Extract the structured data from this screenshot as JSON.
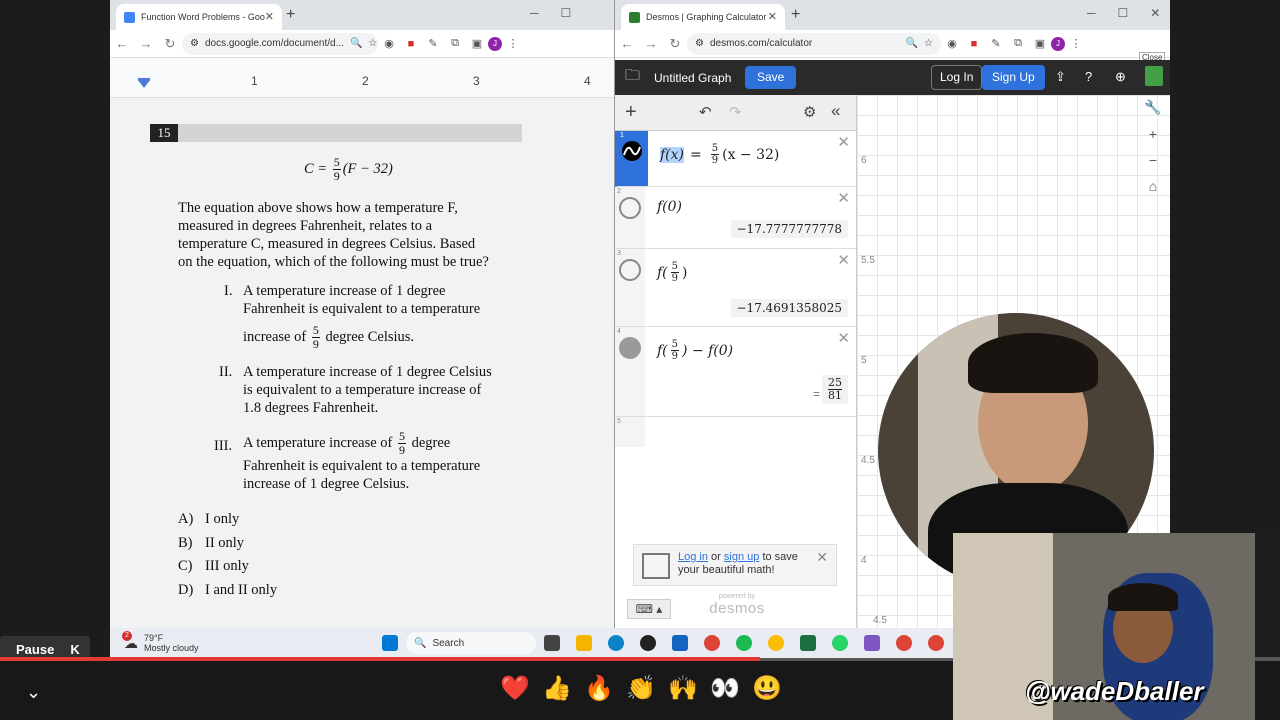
{
  "docs_window": {
    "tab_title": "Function Word Problems - Goo",
    "url": "docs.google.com/document/d...",
    "profile_initial": "J",
    "ruler_numbers": [
      "1",
      "2",
      "3",
      "4"
    ],
    "question_number": "15",
    "equation": {
      "lhs": "C =",
      "num": "5",
      "den": "9",
      "rhs": "(F − 32)"
    },
    "stem": [
      "The equation above shows how a temperature  F,",
      "measured in degrees Fahrenheit, relates to a",
      "temperature  C, measured in degrees Celsius.  Based",
      "on the equation, which of the following must be true?"
    ],
    "statements": [
      {
        "num": "I.",
        "line1": "A temperature increase of  1 degree",
        "line2": "Fahrenheit is equivalent to a temperature",
        "line3_pre": "increase of",
        "frac_num": "5",
        "frac_den": "9",
        "line3_post": "degree Celsius."
      },
      {
        "num": "II.",
        "line1": "A temperature increase of  1 degree Celsius",
        "line2": "is equivalent to a temperature increase of",
        "line3": "1.8 degrees Fahrenheit."
      },
      {
        "num": "III.",
        "line1_pre": "A temperature increase of",
        "frac_num": "5",
        "frac_den": "9",
        "line1_post": "degree",
        "line2": "Fahrenheit is equivalent to a temperature",
        "line3": "increase of 1 degree Celsius."
      }
    ],
    "choices": [
      {
        "letter": "A)",
        "text": "I only"
      },
      {
        "letter": "B)",
        "text": "II only"
      },
      {
        "letter": "C)",
        "text": "III only"
      },
      {
        "letter": "D)",
        "text": "I and II only"
      }
    ]
  },
  "desmos_window": {
    "tab_title": "Desmos | Graphing Calculator",
    "url": "desmos.com/calculator",
    "profile_initial": "J",
    "close_tooltip": "Close",
    "graph_title": "Untitled Graph",
    "save_label": "Save",
    "login_label": "Log In",
    "signup_label": "Sign Up",
    "expressions": [
      {
        "index": "1",
        "lhs": "f(x)",
        "eq": "=",
        "frac_num": "5",
        "frac_den": "9",
        "rhs": "(x − 32)"
      },
      {
        "index": "2",
        "expr": "f(0)",
        "result": "−17.7777777778"
      },
      {
        "index": "3",
        "expr_pre": "f(",
        "frac_num": "5",
        "frac_den": "9",
        "expr_post": ")",
        "result": "−17.4691358025"
      },
      {
        "index": "4",
        "expr_pre": "f(",
        "frac_num": "5",
        "frac_den": "9",
        "expr_post": ") − f(0)",
        "result_num": "25",
        "result_den": "81"
      },
      {
        "index": "5"
      }
    ],
    "promo": {
      "login": "Log in",
      "or": "or",
      "signup": "sign up",
      "rest": "to save your beautiful math!"
    },
    "powered_by": "powered by",
    "brand": "desmos",
    "axis_labels": [
      "6",
      "5.5",
      "5",
      "4.5",
      "4",
      "4.5"
    ]
  },
  "taskbar": {
    "temperature": "79°F",
    "weather": "Mostly cloudy",
    "weather_badge": "2",
    "search_label": "Search"
  },
  "player": {
    "pause_label": "Pause",
    "pause_key": "K",
    "progress_fraction": 0.594,
    "reactions": [
      "❤️",
      "👍",
      "🔥",
      "👏",
      "🙌",
      "👀",
      "😃"
    ]
  },
  "overlay": {
    "handle": "@wadeDballer"
  }
}
